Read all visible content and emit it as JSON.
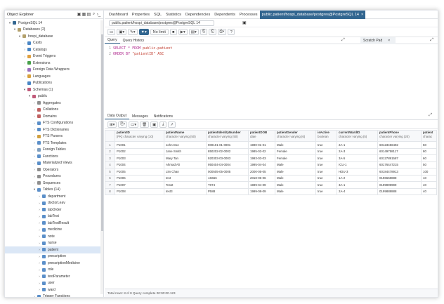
{
  "explorer": {
    "title": "Object Explorer",
    "icons": [
      "database-icon",
      "grid-icon",
      "table-icon",
      "search-icon",
      "terminal-icon"
    ],
    "tree": [
      {
        "d": 0,
        "tg": "▾",
        "label": "PostgreSQL 14",
        "c": "#336791"
      },
      {
        "d": 1,
        "tg": "▾",
        "label": "Databases (2)",
        "c": "#b3a06b"
      },
      {
        "d": 2,
        "tg": "▾",
        "label": "hospi_database",
        "c": "#b3a06b"
      },
      {
        "d": 3,
        "tg": "›",
        "label": "Casts",
        "c": "#4a86c5"
      },
      {
        "d": 3,
        "tg": "›",
        "label": "Catalogs",
        "c": "#4a86c5"
      },
      {
        "d": 3,
        "tg": "›",
        "label": "Event Triggers",
        "c": "#e0a040"
      },
      {
        "d": 3,
        "tg": "›",
        "label": "Extensions",
        "c": "#46a049"
      },
      {
        "d": 3,
        "tg": "›",
        "label": "Foreign Data Wrappers",
        "c": "#9b6fbf"
      },
      {
        "d": 3,
        "tg": "›",
        "label": "Languages",
        "c": "#d8a13d"
      },
      {
        "d": 3,
        "tg": "",
        "label": "Publications",
        "c": "#4a86c5"
      },
      {
        "d": 3,
        "tg": "▾",
        "label": "Schemas (1)",
        "c": "#c05a7a"
      },
      {
        "d": 4,
        "tg": "▾",
        "label": "public",
        "c": "#c05a7a"
      },
      {
        "d": 5,
        "tg": "›",
        "label": "Aggregates",
        "c": "#8e8e8e"
      },
      {
        "d": 5,
        "tg": "›",
        "label": "Collations",
        "c": "#c06060"
      },
      {
        "d": 5,
        "tg": "›",
        "label": "Domains",
        "c": "#c06060"
      },
      {
        "d": 5,
        "tg": "›",
        "label": "FTS Configurations",
        "c": "#5b8fc9"
      },
      {
        "d": 5,
        "tg": "›",
        "label": "FTS Dictionaries",
        "c": "#5b8fc9"
      },
      {
        "d": 5,
        "tg": "›",
        "label": "FTS Parsers",
        "c": "#d0a040"
      },
      {
        "d": 5,
        "tg": "›",
        "label": "FTS Templates",
        "c": "#5b8fc9"
      },
      {
        "d": 5,
        "tg": "›",
        "label": "Foreign Tables",
        "c": "#7f9fbf"
      },
      {
        "d": 5,
        "tg": "›",
        "label": "Functions",
        "c": "#5b8fc9"
      },
      {
        "d": 5,
        "tg": "›",
        "label": "Materialized Views",
        "c": "#5b8fc9"
      },
      {
        "d": 5,
        "tg": "›",
        "label": "Operators",
        "c": "#8e8e8e"
      },
      {
        "d": 5,
        "tg": "›",
        "label": "Procedures",
        "c": "#8e8e8e"
      },
      {
        "d": 5,
        "tg": "›",
        "label": "Sequences",
        "c": "#8e8e8e"
      },
      {
        "d": 5,
        "tg": "▾",
        "label": "Tables (14)",
        "c": "#5b8fc9"
      },
      {
        "d": 6,
        "tg": "›",
        "label": "department",
        "c": "#5b8fc9"
      },
      {
        "d": 6,
        "tg": "›",
        "label": "doctorLeav",
        "c": "#5b8fc9"
      },
      {
        "d": 6,
        "tg": "›",
        "label": "labOrder",
        "c": "#5b8fc9"
      },
      {
        "d": 6,
        "tg": "›",
        "label": "labTest",
        "c": "#5b8fc9"
      },
      {
        "d": 6,
        "tg": "›",
        "label": "labTestResult",
        "c": "#5b8fc9"
      },
      {
        "d": 6,
        "tg": "›",
        "label": "medicine",
        "c": "#5b8fc9"
      },
      {
        "d": 6,
        "tg": "›",
        "label": "note",
        "c": "#5b8fc9"
      },
      {
        "d": 6,
        "tg": "›",
        "label": "nurse",
        "c": "#5b8fc9"
      },
      {
        "d": 6,
        "tg": "›",
        "label": "patient",
        "c": "#5b8fc9",
        "sel": true
      },
      {
        "d": 6,
        "tg": "›",
        "label": "prescription",
        "c": "#5b8fc9"
      },
      {
        "d": 6,
        "tg": "›",
        "label": "prescriptionMedicine",
        "c": "#5b8fc9"
      },
      {
        "d": 6,
        "tg": "›",
        "label": "role",
        "c": "#5b8fc9"
      },
      {
        "d": 6,
        "tg": "›",
        "label": "testParameter",
        "c": "#5b8fc9"
      },
      {
        "d": 6,
        "tg": "›",
        "label": "user",
        "c": "#5b8fc9"
      },
      {
        "d": 6,
        "tg": "›",
        "label": "ward",
        "c": "#5b8fc9"
      },
      {
        "d": 5,
        "tg": "›",
        "label": "Trigger Functions",
        "c": "#5b8fc9"
      }
    ]
  },
  "tabs": [
    "Dashboard",
    "Properties",
    "SQL",
    "Statistics",
    "Dependencies",
    "Dependents",
    "Processes"
  ],
  "active_tab": "public.patient/hospi_database/postgres@PostgreSQL 14",
  "connection": "public.patient/hospi_database/postgres@PostgreSQL 14",
  "toolbar": {
    "limit": "No limit"
  },
  "query_tabs": [
    "Query",
    "Query History"
  ],
  "scratch_pad": "Scratch Pad",
  "sql": {
    "line1": "1",
    "line2": "2",
    "kw1": "SELECT * FROM",
    "t1": "public.patient",
    "kw2": "ORDER BY",
    "t2": "\"patientID\" ASC"
  },
  "data_tabs": [
    "Data Output",
    "Messages",
    "Notifications"
  ],
  "columns": [
    {
      "name": "patientID",
      "type": "[PK] character varying (10)"
    },
    {
      "name": "patientName",
      "type": "character varying (50)"
    },
    {
      "name": "patientIdentityNumber",
      "type": "character varying (50)"
    },
    {
      "name": "patientDOB",
      "type": "date"
    },
    {
      "name": "patientGender",
      "type": "character varying (6)"
    },
    {
      "name": "isActive",
      "type": "boolean"
    },
    {
      "name": "currentWardID",
      "type": "character varying (5)"
    },
    {
      "name": "patientPhone",
      "type": "character varying (20)"
    },
    {
      "name": "patient",
      "type": "charac"
    }
  ],
  "rows": [
    [
      "1",
      "P1001",
      "John Doe",
      "900101-01-0001",
      "1990-01-01",
      "Male",
      "true",
      "2A-1",
      "60123456492",
      "50"
    ],
    [
      "2",
      "P1002",
      "Jane Smith",
      "850202-02-0002",
      "1985-02-02",
      "Female",
      "true",
      "2A-3",
      "60149758117",
      "80"
    ],
    [
      "3",
      "P1003",
      "Mary Tan",
      "920303-03-0003",
      "1993-03-03",
      "Female",
      "true",
      "3A-5",
      "60127891587",
      "60"
    ],
    [
      "4",
      "P1004",
      "Ahmad Ali",
      "950404-04-0004",
      "1995-04-04",
      "Male",
      "true",
      "ICU-1",
      "60176447215",
      "50"
    ],
    [
      "5",
      "P1005",
      "Lim Chan",
      "000505-05-0005",
      "2000-05-05",
      "Male",
      "true",
      "HDU-3",
      "60184478913",
      "100"
    ],
    [
      "6",
      "P1006",
      "test",
      "A6666",
      "2018-06-06",
      "Male",
      "true",
      "1A-2",
      "0196668888",
      "10"
    ],
    [
      "7",
      "P1007",
      "Test2",
      "T074",
      "1999-04-09",
      "Male",
      "true",
      "3A-1",
      "0199999999",
      "40"
    ],
    [
      "8",
      "P1008",
      "test3",
      "P588",
      "1999-08-09",
      "Male",
      "true",
      "2A-4",
      "0199888888",
      "40"
    ]
  ],
  "status": "Total rows: 8 of 8     Query complete 00:00:00.123"
}
